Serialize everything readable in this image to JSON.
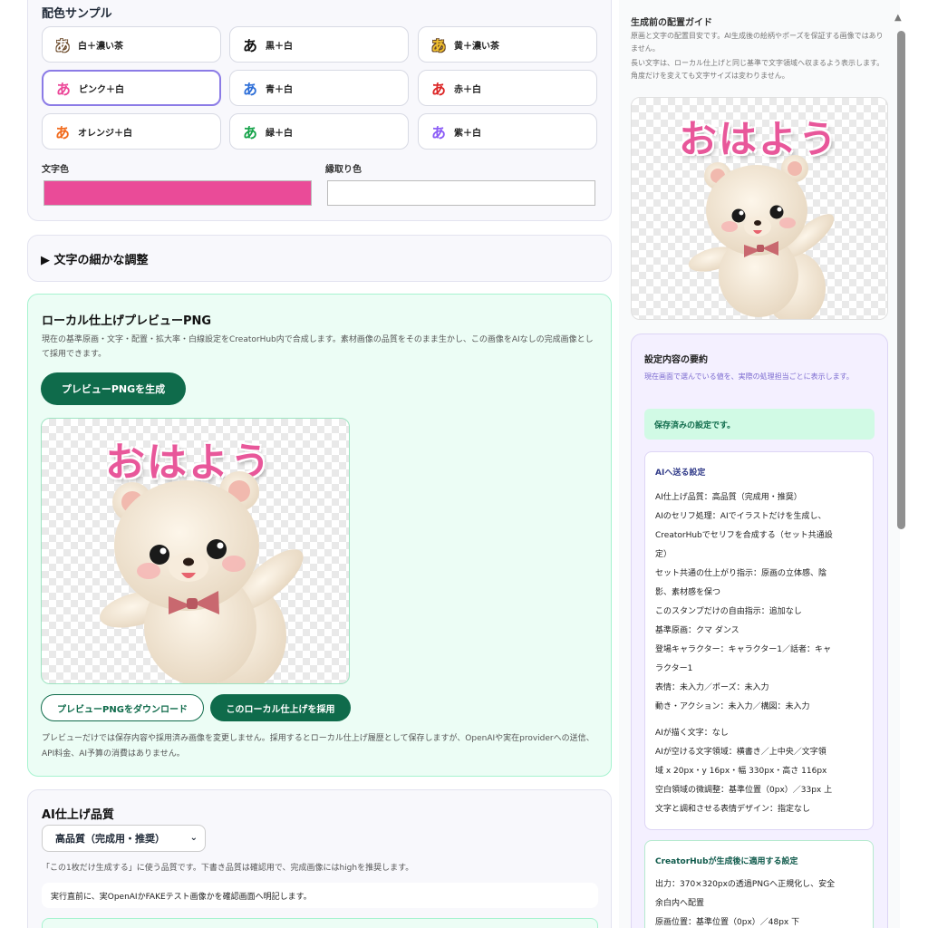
{
  "swatches": {
    "title": "配色サンプル",
    "items": [
      {
        "glyph": "あ",
        "label": "白＋濃い茶",
        "color": "#ffffff",
        "stroke": "#6b4a2a"
      },
      {
        "glyph": "あ",
        "label": "黒＋白",
        "color": "#111111",
        "stroke": "#ffffff"
      },
      {
        "glyph": "あ",
        "label": "黄＋濃い茶",
        "color": "#f2c230",
        "stroke": "#6b4a2a"
      },
      {
        "glyph": "あ",
        "label": "ピンク＋白",
        "color": "#ec4899",
        "stroke": "#ffffff"
      },
      {
        "glyph": "あ",
        "label": "青＋白",
        "color": "#2e6fd8",
        "stroke": "#ffffff"
      },
      {
        "glyph": "あ",
        "label": "赤＋白",
        "color": "#dc2626",
        "stroke": "#ffffff"
      },
      {
        "glyph": "あ",
        "label": "オレンジ＋白",
        "color": "#f26b1d",
        "stroke": "#ffffff"
      },
      {
        "glyph": "あ",
        "label": "緑＋白",
        "color": "#16a34a",
        "stroke": "#ffffff"
      },
      {
        "glyph": "あ",
        "label": "紫＋白",
        "color": "#8b5cf6",
        "stroke": "#ffffff"
      }
    ],
    "selected_index": 3,
    "text_color_label": "文字色",
    "text_color": "#ea4b98",
    "stroke_color_label": "縁取り色",
    "stroke_color": "#ffffff"
  },
  "adjust": {
    "title": "▶  文字の細かな調整"
  },
  "preview": {
    "title": "ローカル仕上げプレビューPNG",
    "desc": "現在の基準原画・文字・配置・拡大率・白線設定をCreatorHub内で合成します。素材画像の品質をそのまま生かし、この画像をAIなしの完成画像として採用できます。",
    "generate_label": "プレビューPNGを生成",
    "image_text": "おはよう",
    "download_label": "プレビューPNGをダウンロード",
    "adopt_label": "このローカル仕上げを採用",
    "note": "プレビューだけでは保存内容や採用済み画像を変更しません。採用するとローカル仕上げ履歴として保存しますが、OpenAIや実在providerへの送信、API料金、AI予算の消費はありません。"
  },
  "quality": {
    "title": "AI仕上げ品質",
    "selected": "高品質（完成用・推奨）",
    "desc": "「この1枚だけ生成する」に使う品質です。下書き品質は確認用で、完成画像にはhighを推奨します。",
    "note": "実行直前に、実OpenAIかFAKEテスト画像かを確認画面へ明記します。"
  },
  "sidebar": {
    "guide_title": "生成前の配置ガイド",
    "guide_desc_1": "原画と文字の配置目安です。AI生成後の絵柄やポーズを保証する画像ではありません。",
    "guide_desc_2": "長い文字は、ローカル仕上げと同じ基準で文字領域へ収まるよう表示します。角度だけを変えても文字サイズは変わりません。",
    "image_text": "おはよう",
    "summary": {
      "title": "設定内容の要約",
      "desc": "現在画面で選んでいる値を、実際の処理担当ごとに表示します。",
      "saved": "保存済みの設定です。",
      "ai_title": "AIへ送る設定",
      "ai_lines_1": [
        "AI仕上げ品質：高品質（完成用・推奨）",
        "AIのセリフ処理：AIでイラストだけを生成し、",
        "CreatorHubでセリフを合成する（セット共通設",
        "定）",
        "セット共通の仕上がり指示：原画の立体感、陰",
        "影、素材感を保つ",
        "このスタンプだけの自由指示：追加なし",
        "基準原画：クマ ダンス",
        "登場キャラクター：キャラクター1／話者：キャ",
        "ラクター1",
        "表情：未入力／ポーズ：未入力",
        "動き・アクション：未入力／構図：未入力"
      ],
      "ai_lines_2": [
        "AIが描く文字：なし",
        "AIが空ける文字領域：横書き／上中央／文字領",
        "域 x 20px・y 16px・幅 330px・高さ 116px",
        "空白領域の微調整：基準位置（0px）／33px 上",
        "文字と調和させる表情デザイン：指定なし"
      ],
      "hub_title": "CreatorHubが生成後に適用する設定",
      "hub_lines": [
        "出力：370×320pxの透過PNGへ正規化し、安全",
        "余白内へ配置",
        "原画位置：基準位置（0px）／48px 下"
      ]
    }
  }
}
